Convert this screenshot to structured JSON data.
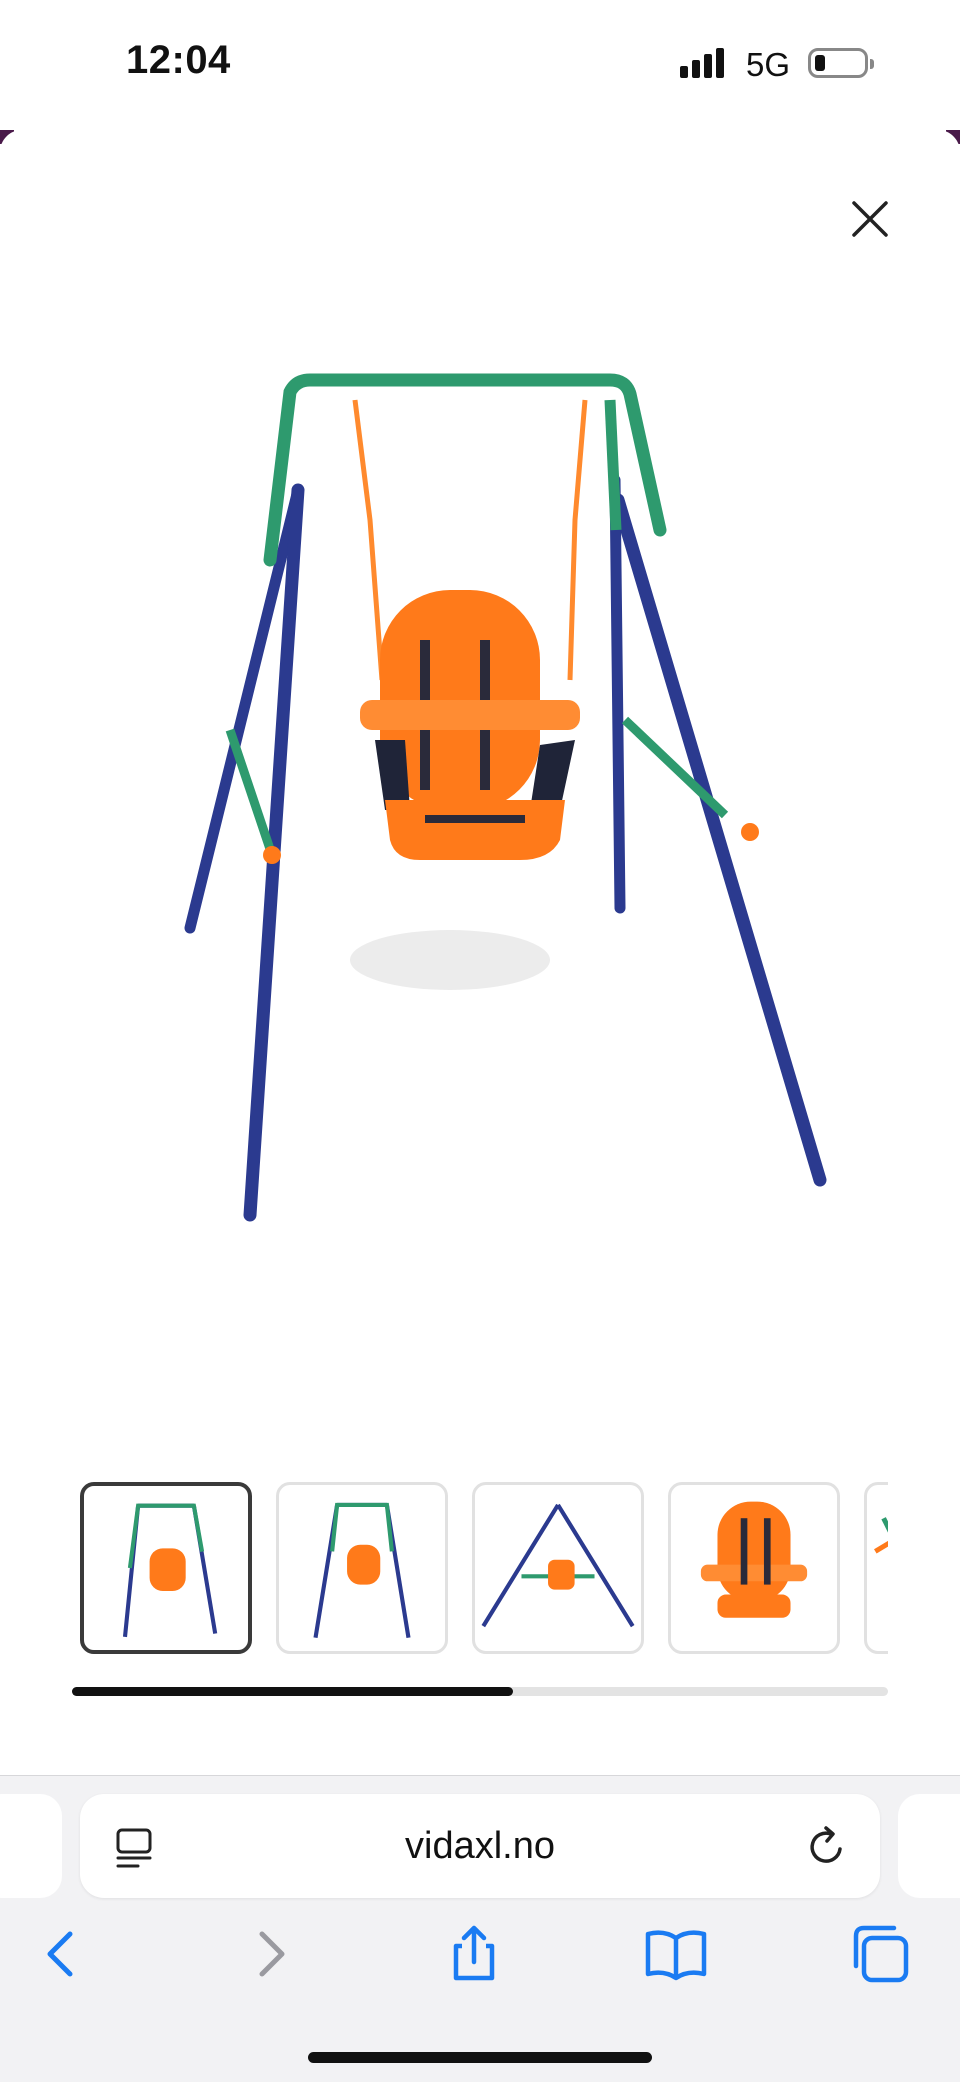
{
  "status_bar": {
    "time": "12:04",
    "network": "5G",
    "signal_bars": 4,
    "battery_level": 0.2
  },
  "gallery": {
    "close_icon": "close-icon",
    "main_image_alt": "orange toddler swing on green and blue frame",
    "thumbnails": [
      {
        "view": "front",
        "selected": true
      },
      {
        "view": "front-alt",
        "selected": false
      },
      {
        "view": "side",
        "selected": false
      },
      {
        "view": "seat-closeup",
        "selected": false
      },
      {
        "view": "detail",
        "selected": false
      }
    ],
    "scroll_progress": 0.54
  },
  "browser": {
    "url": "vidaxl.no",
    "reader_icon": "reader-mode-icon",
    "reload_icon": "reload-icon",
    "toolbar": [
      {
        "name": "back-icon",
        "enabled": true
      },
      {
        "name": "forward-icon",
        "enabled": false
      },
      {
        "name": "share-icon",
        "enabled": true
      },
      {
        "name": "bookmarks-icon",
        "enabled": true
      },
      {
        "name": "tabs-icon",
        "enabled": true
      }
    ]
  },
  "colors": {
    "frame_green": "#2e9a6e",
    "frame_blue": "#2b3a8f",
    "seat_orange": "#ff7a1a",
    "ios_blue": "#1a7bf2"
  }
}
